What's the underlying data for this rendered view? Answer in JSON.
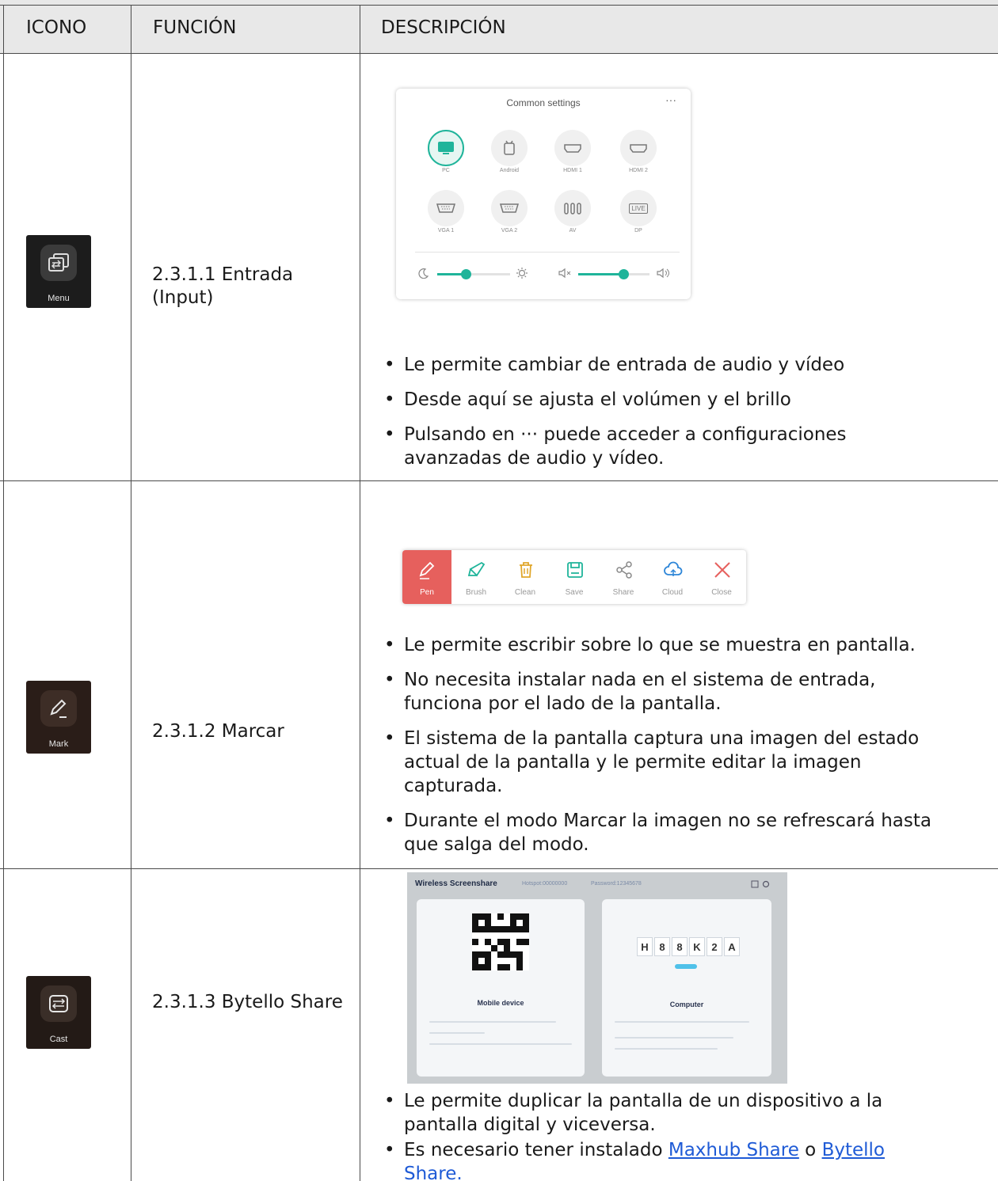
{
  "table": {
    "headers": [
      "ICONO",
      "FUNCIÓN",
      "DESCRIPCIÓN"
    ],
    "rows": [
      {
        "icon_caption": "Menu",
        "function": "2.3.1.1 Entrada (Input)",
        "bullets": [
          "Le permite cambiar de entrada de audio y vídeo",
          "Desde aquí se ajusta el volúmen y el brillo",
          "Pulsando en ··· puede acceder a configuraciones avanzadas de audio y vídeo."
        ]
      },
      {
        "icon_caption": "Mark",
        "function": "2.3.1.2 Marcar",
        "bullets": [
          "Le permite escribir sobre lo que se muestra en pantalla.",
          "No necesita instalar nada en el sistema de entrada, funciona por el lado de la pantalla.",
          "El sistema de la pantalla captura una imagen del estado actual de la pantalla y le permite editar la imagen capturada.",
          "Durante el modo Marcar la imagen no se refrescará hasta que salga del modo."
        ]
      },
      {
        "icon_caption": "Cast",
        "function": "2.3.1.3 Bytello Share",
        "bullets": [
          "Le permite duplicar la pantalla de un dispositivo a la pantalla digital y viceversa."
        ],
        "bullet_links": {
          "prefix": "Es necesario tener instalado ",
          "link1": "Maxhub Share",
          "middle": " o ",
          "link2": "Bytello Share."
        }
      }
    ]
  },
  "settings_panel": {
    "title": "Common settings",
    "more": "···",
    "sources": [
      "PC",
      "Android",
      "HDMI 1",
      "HDMI 2",
      "VGA 1",
      "VGA 2",
      "AV",
      "DP"
    ],
    "live_label": "LIVE"
  },
  "toolbar": {
    "tools": [
      "Pen",
      "Brush",
      "Clean",
      "Save",
      "Share",
      "Cloud",
      "Close"
    ]
  },
  "screenshare": {
    "title": "Wireless Screenshare",
    "hotspot": "Hotspot:00000000",
    "password": "Password:12345678",
    "code": [
      "H",
      "8",
      "8",
      "K",
      "2",
      "A"
    ],
    "mobile_title": "Mobile device",
    "computer_title": "Computer"
  },
  "colors": {
    "accent_teal": "#1fb49a",
    "pen_red": "#e6605d",
    "link_blue": "#1f5bd6",
    "header_bg": "#e8e8e8"
  }
}
